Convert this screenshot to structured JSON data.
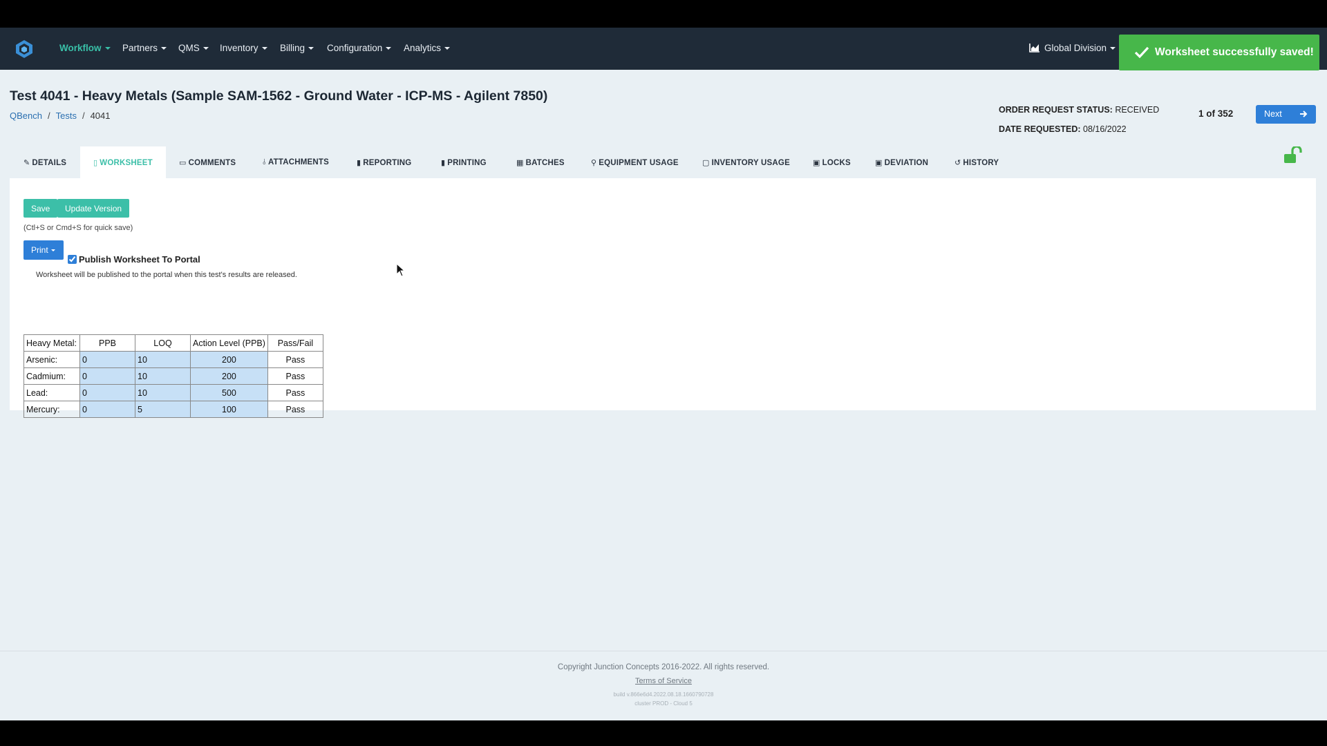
{
  "nav": {
    "items": [
      {
        "label": "Workflow",
        "active": true
      },
      {
        "label": "Partners"
      },
      {
        "label": "QMS"
      },
      {
        "label": "Inventory"
      },
      {
        "label": "Billing"
      },
      {
        "label": "Configuration"
      },
      {
        "label": "Analytics"
      }
    ],
    "division": "Global Division",
    "division_icon": "area-chart-icon",
    "logo_icon": "qbench-logo-icon"
  },
  "toast": {
    "message": "Worksheet successfully saved!",
    "color": "#47b74a"
  },
  "header": {
    "title": "Test 4041 - Heavy Metals (Sample SAM-1562 - Ground Water - ICP-MS - Agilent 7850)",
    "breadcrumb": [
      "QBench",
      "Tests",
      "4041"
    ],
    "order_status_label": "ORDER REQUEST STATUS:",
    "order_status_value": "RECEIVED",
    "date_requested_label": "DATE REQUESTED:",
    "date_requested_value": "08/16/2022",
    "page_count": "1 of 352",
    "next_label": "Next"
  },
  "tabs": [
    {
      "label": "DETAILS",
      "icon": "pencil-icon"
    },
    {
      "label": "WORKSHEET",
      "icon": "document-icon",
      "active": true
    },
    {
      "label": "COMMENTS",
      "icon": "comment-icon"
    },
    {
      "label": "ATTACHMENTS",
      "icon": "paperclip-icon"
    },
    {
      "label": "REPORTING",
      "icon": "file-icon"
    },
    {
      "label": "PRINTING",
      "icon": "file-icon"
    },
    {
      "label": "BATCHES",
      "icon": "grid-icon"
    },
    {
      "label": "EQUIPMENT USAGE",
      "icon": "map-marker-icon"
    },
    {
      "label": "INVENTORY USAGE",
      "icon": "box-icon"
    },
    {
      "label": "LOCKS",
      "icon": "lock-icon"
    },
    {
      "label": "DEVIATION",
      "icon": "alert-file-icon"
    },
    {
      "label": "HISTORY",
      "icon": "history-icon"
    }
  ],
  "worksheet": {
    "save_label": "Save",
    "update_version_label": "Update Version",
    "hint": "(Ctl+S or Cmd+S for quick save)",
    "print_label": "Print",
    "publish_label": "Publish Worksheet To Portal",
    "publish_checked": true,
    "publish_note": "Worksheet will be published to the portal when this test's results are released.",
    "table": {
      "headers": [
        "Heavy Metal:",
        "PPB",
        "LOQ",
        "Action Level (PPB)",
        "Pass/Fail"
      ],
      "rows": [
        [
          "Arsenic:",
          "0",
          "10",
          "200",
          "Pass"
        ],
        [
          "Cadmium:",
          "0",
          "10",
          "200",
          "Pass"
        ],
        [
          "Lead:",
          "0",
          "10",
          "500",
          "Pass"
        ],
        [
          "Mercury:",
          "0",
          "5",
          "100",
          "Pass"
        ]
      ]
    }
  },
  "footer": {
    "copyright": "Copyright Junction Concepts 2016-2022. All rights reserved.",
    "terms": "Terms of Service",
    "build": "build v.866e6d4.2022.08.18.1660790728",
    "cluster": "cluster PROD - Cloud 5"
  }
}
